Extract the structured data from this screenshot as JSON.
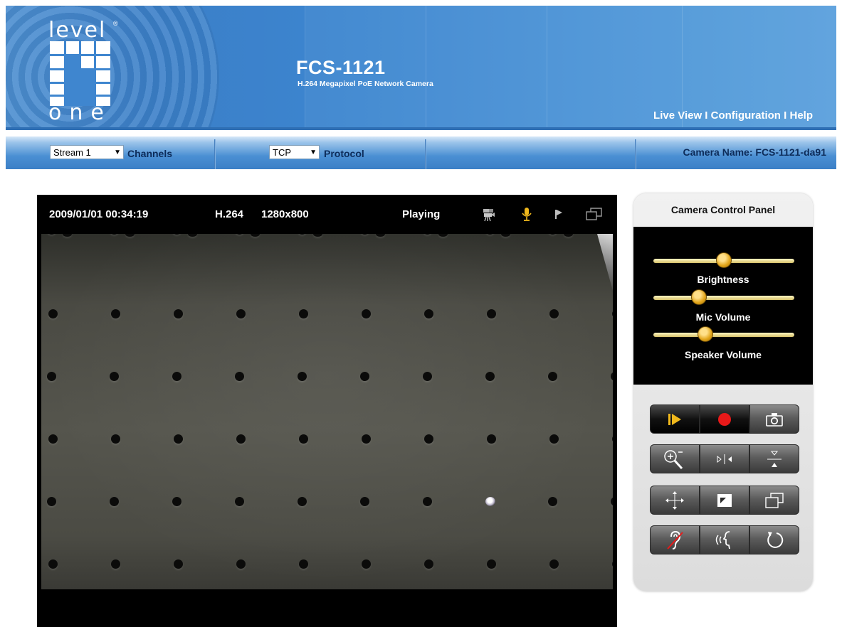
{
  "header": {
    "logo_top": "level",
    "logo_reg": "®",
    "logo_bottom": "one",
    "product_title": "FCS-1121",
    "product_subtitle": "H.264 Megapixel PoE Network Camera",
    "nav": {
      "live_view": "Live View",
      "sep1": " I ",
      "configuration": "Configuration",
      "sep2": " I ",
      "help": "Help"
    }
  },
  "toolbar": {
    "stream_value": "Stream 1",
    "channels_label": "Channels",
    "protocol_value": "TCP",
    "protocol_label": "Protocol",
    "camera_name": "Camera Name: FCS-1121-da91"
  },
  "player": {
    "timestamp": "2009/01/01  00:34:19",
    "codec": "H.264",
    "resolution": "1280x800",
    "state": "Playing",
    "icons": [
      "video-record-icon",
      "microphone-icon",
      "speaker-icon",
      "fullscreen-icon"
    ]
  },
  "panel": {
    "title": "Camera Control Panel",
    "sliders": [
      {
        "label": "Brightness",
        "level": 0.5
      },
      {
        "label": "Mic Volume",
        "level": 0.3
      },
      {
        "label": "Speaker Volume",
        "level": 0.35
      }
    ],
    "buttons": [
      [
        "play-icon",
        "record-icon",
        "snapshot-icon"
      ],
      [
        "zoom-icon",
        "mirror-icon",
        "flip-icon"
      ],
      [
        "move-icon",
        "crop-icon",
        "window-icon"
      ],
      [
        "listen-mute-icon",
        "talk-icon",
        "reset-icon"
      ]
    ]
  },
  "colors": {
    "header_blue": "#3b7fc8",
    "toolbar_text": "#0d2c5a",
    "knob_gold": "#e2a51a",
    "record_red": "#e81919"
  }
}
